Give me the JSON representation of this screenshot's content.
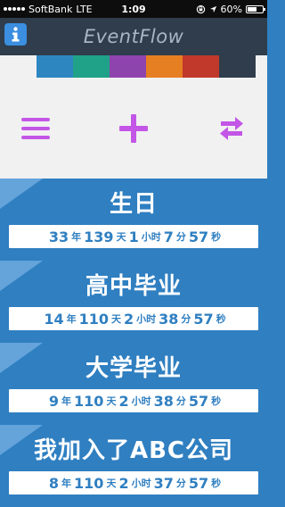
{
  "status_bar": {
    "carrier": "SoftBank",
    "network": "LTE",
    "time": "1:09",
    "battery": "60%",
    "battery_level": 0.6
  },
  "header": {
    "title": "EventFlow"
  },
  "color_strip": [
    "#f1f1f1",
    "#2e86c1",
    "#1fa287",
    "#8e44ad",
    "#e67e22",
    "#c0392b",
    "#2f3d4c"
  ],
  "icons": {
    "info": "info-icon",
    "menu": "hamburger-menu-icon",
    "add": "plus-icon",
    "sync": "repeat-icon"
  },
  "accent_color": "#c356e6",
  "events": [
    {
      "title": "生日",
      "parts": [
        {
          "n": "33",
          "u": "年"
        },
        {
          "n": "139",
          "u": "天"
        },
        {
          "n": "1",
          "u": "小时"
        },
        {
          "n": "7",
          "u": "分"
        },
        {
          "n": "57",
          "u": "秒"
        }
      ]
    },
    {
      "title": "高中毕业",
      "parts": [
        {
          "n": "14",
          "u": "年"
        },
        {
          "n": "110",
          "u": "天"
        },
        {
          "n": "2",
          "u": "小时"
        },
        {
          "n": "38",
          "u": "分"
        },
        {
          "n": "57",
          "u": "秒"
        }
      ]
    },
    {
      "title": "大学毕业",
      "parts": [
        {
          "n": "9",
          "u": "年"
        },
        {
          "n": "110",
          "u": "天"
        },
        {
          "n": "2",
          "u": "小时"
        },
        {
          "n": "38",
          "u": "分"
        },
        {
          "n": "57",
          "u": "秒"
        }
      ]
    },
    {
      "title": "我加入了ABC公司",
      "parts": [
        {
          "n": "8",
          "u": "年"
        },
        {
          "n": "110",
          "u": "天"
        },
        {
          "n": "2",
          "u": "小时"
        },
        {
          "n": "37",
          "u": "分"
        },
        {
          "n": "57",
          "u": "秒"
        }
      ]
    }
  ]
}
